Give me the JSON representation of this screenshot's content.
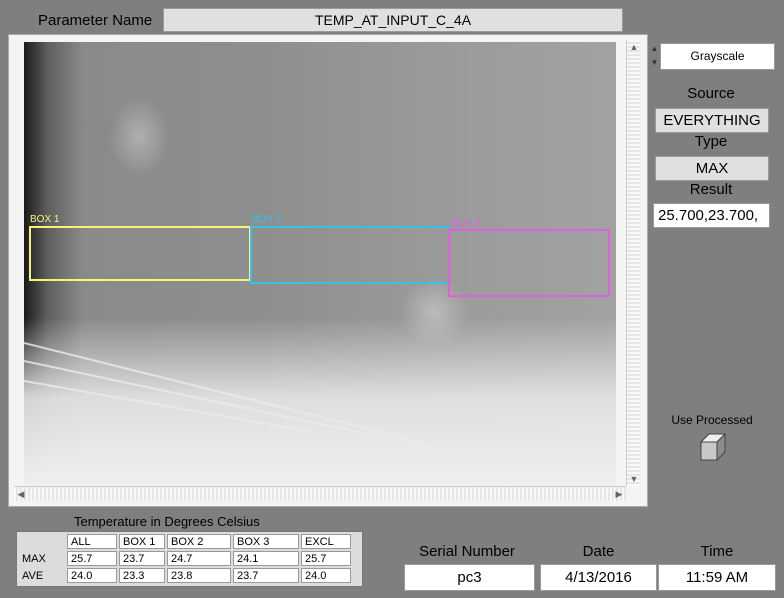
{
  "parameter": {
    "label": "Parameter Name",
    "value": "TEMP_AT_INPUT_C_4A"
  },
  "image": {
    "rois": [
      {
        "label": "BOX 1",
        "color": "#f4f47a"
      },
      {
        "label": "BOX 2",
        "color": "#33c3e6"
      },
      {
        "label": "BOX 3",
        "color": "#e35ce3"
      }
    ]
  },
  "palette": {
    "value": "Grayscale"
  },
  "source": {
    "label": "Source",
    "value": "EVERYTHING"
  },
  "type": {
    "label": "Type",
    "value": "MAX"
  },
  "result": {
    "label": "Result",
    "value": "25.700,23.700,"
  },
  "use_processed": {
    "label": "Use Processed"
  },
  "temperature_table": {
    "title": "Temperature in Degrees Celsius",
    "columns": [
      "ALL",
      "BOX 1",
      "BOX 2",
      "BOX 3",
      "EXCL"
    ],
    "rows": [
      {
        "name": "MAX",
        "values": [
          "25.7",
          "23.7",
          "24.7",
          "24.1",
          "25.7"
        ]
      },
      {
        "name": "AVE",
        "values": [
          "24.0",
          "23.3",
          "23.8",
          "23.7",
          "24.0"
        ]
      }
    ]
  },
  "serial": {
    "label": "Serial Number",
    "value": "pc3"
  },
  "date": {
    "label": "Date",
    "value": "4/13/2016"
  },
  "time": {
    "label": "Time",
    "value": "11:59 AM"
  }
}
